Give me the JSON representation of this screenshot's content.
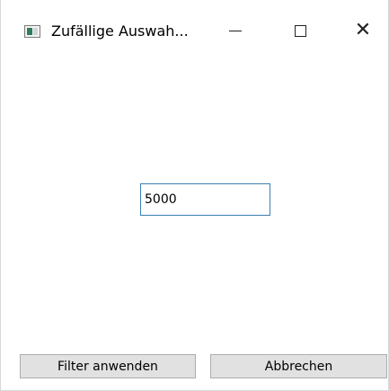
{
  "window": {
    "title": "Zufällige Auswah...",
    "icon": "app-window-icon",
    "controls": {
      "minimize_icon": "minimize-icon",
      "maximize_icon": "maximize-icon",
      "close_icon": "close-icon",
      "close_glyph": "✕"
    }
  },
  "main": {
    "count_input": {
      "value": "5000"
    }
  },
  "buttons": {
    "apply_label": "Filter anwenden",
    "cancel_label": "Abbrechen"
  },
  "colors": {
    "input_border": "#3c7fb1",
    "button_face": "#e1e1e1",
    "button_border": "#adadad"
  }
}
